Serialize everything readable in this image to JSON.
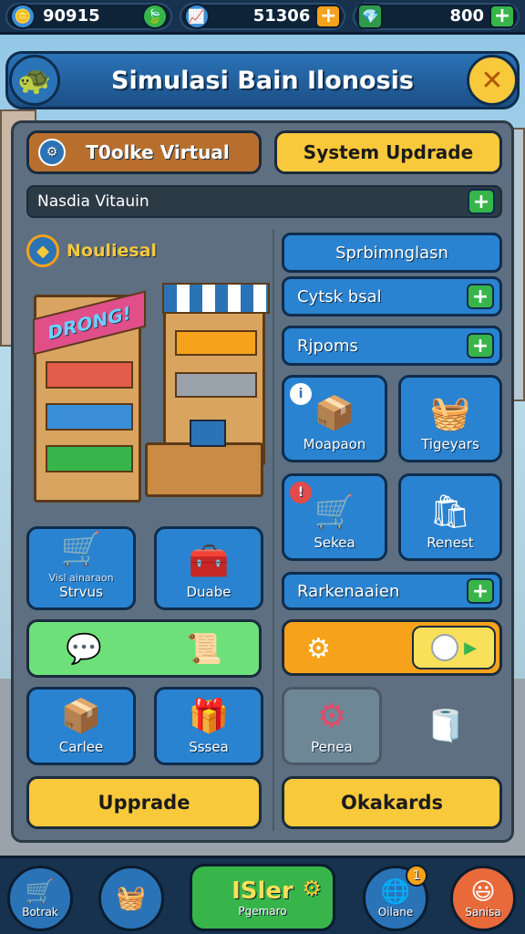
{
  "colors": {
    "topbar_bg": "#16324f",
    "title_blue": "#2b73b7",
    "accent_orange": "#f6a21a",
    "accent_yellow": "#f9c93c",
    "green": "#37b54a",
    "tile_blue": "#2a83d0",
    "panel_gray": "#5d6f80"
  },
  "resources": [
    {
      "value": "90915",
      "icon": "coin-icon",
      "action_icon": "leaf-icon"
    },
    {
      "value": "51306",
      "icon": "chart-icon",
      "action_icon": "plus-icon"
    },
    {
      "value": "800",
      "icon": "gem-icon",
      "action_icon": "plus-icon"
    }
  ],
  "header": {
    "title": "Simulasi Bain Ilonosis",
    "left_icon": "turtle-icon",
    "close_icon": "close-icon"
  },
  "tabs": {
    "left": "T0olke Virtual",
    "right": "System Updrade"
  },
  "search": {
    "value": "Nasdia Vitauin"
  },
  "left_section": {
    "title": "Nouliesal",
    "shop_sign": "DRONG!",
    "tiles": [
      {
        "label": "Strvus",
        "sublabel": "Visl ainaraon",
        "icon": "cart-icon"
      },
      {
        "label": "Duabe",
        "icon": "box-icon"
      }
    ],
    "chat_bar_icons": [
      "chat-icon",
      "scroll-icon"
    ],
    "tiles2": [
      {
        "label": "Carlee",
        "icon": "crate-icon"
      },
      {
        "label": "Sssea",
        "icon": "package-icon"
      }
    ],
    "upgrade_button": "Upprade"
  },
  "right_section": {
    "header": "Sprbimnglasn",
    "rows": [
      "Cytsk bsal",
      "Rjpoms"
    ],
    "tiles": [
      {
        "label": "Moapaon",
        "icon": "open-box-icon",
        "badge": "info"
      },
      {
        "label": "Tigeyars",
        "icon": "cart-tray-icon"
      },
      {
        "label": "Sekea",
        "icon": "cart-gold-icon",
        "badge": "alert"
      },
      {
        "label": "Renest",
        "icon": "cart-green-icon"
      }
    ],
    "row3": "Rarkenaaien",
    "settings_icons": [
      "gear-icon",
      "coin-icon"
    ],
    "misc_tiles": [
      {
        "label": "Penea",
        "icon": "cog-icon"
      },
      {
        "label": "",
        "icon": "pipe-icon"
      }
    ],
    "bottom_button": "Okakards"
  },
  "bottom_nav": [
    {
      "label": "Botrak",
      "icon": "cart-icon"
    },
    {
      "label": "",
      "icon": "basket-icon"
    },
    {
      "label": "Pgemaro",
      "title": "ISler",
      "icon": "gear-icon"
    },
    {
      "label": "Oilane",
      "icon": "globe-icon",
      "badge": "1"
    },
    {
      "label": "Sanisa",
      "icon": "face-icon"
    }
  ]
}
